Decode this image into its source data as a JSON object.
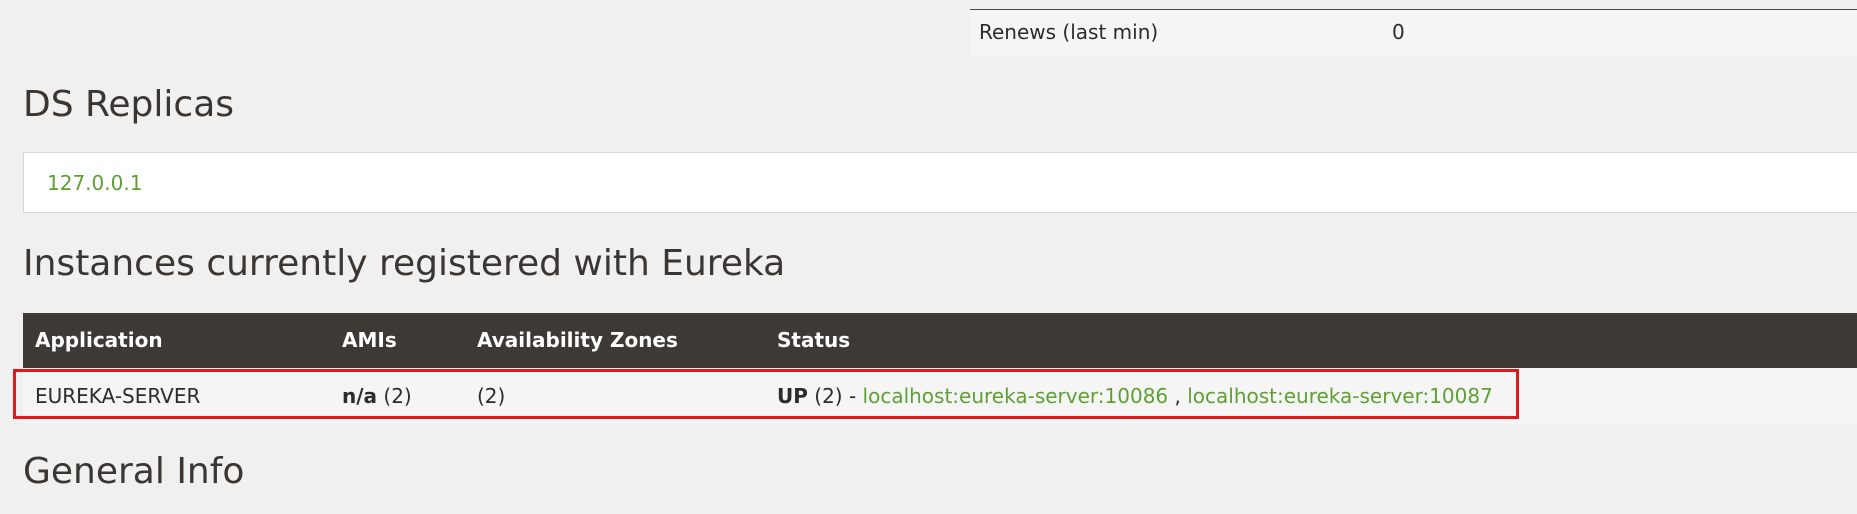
{
  "stats": {
    "label": "Renews (last min)",
    "value": "0"
  },
  "replicas": {
    "title": "DS Replicas",
    "items": [
      "127.0.0.1"
    ]
  },
  "instances": {
    "title": "Instances currently registered with Eureka",
    "headers": {
      "application": "Application",
      "amis": "AMIs",
      "availability_zones": "Availability Zones",
      "status": "Status"
    },
    "rows": [
      {
        "application": "EUREKA-SERVER",
        "amis_label": "n/a",
        "amis_count": " (2)",
        "availability_zones": "(2)",
        "status_label": "UP",
        "status_count": " (2) - ",
        "links": [
          "localhost:eureka-server:10086",
          "localhost:eureka-server:10087"
        ],
        "link_separator": " , "
      }
    ]
  },
  "general": {
    "title": "General Info"
  },
  "colors": {
    "link": "#5ea034",
    "header_bg": "#3d3935",
    "highlight": "#e01a1a",
    "page_bg": "#f0f0f0"
  }
}
